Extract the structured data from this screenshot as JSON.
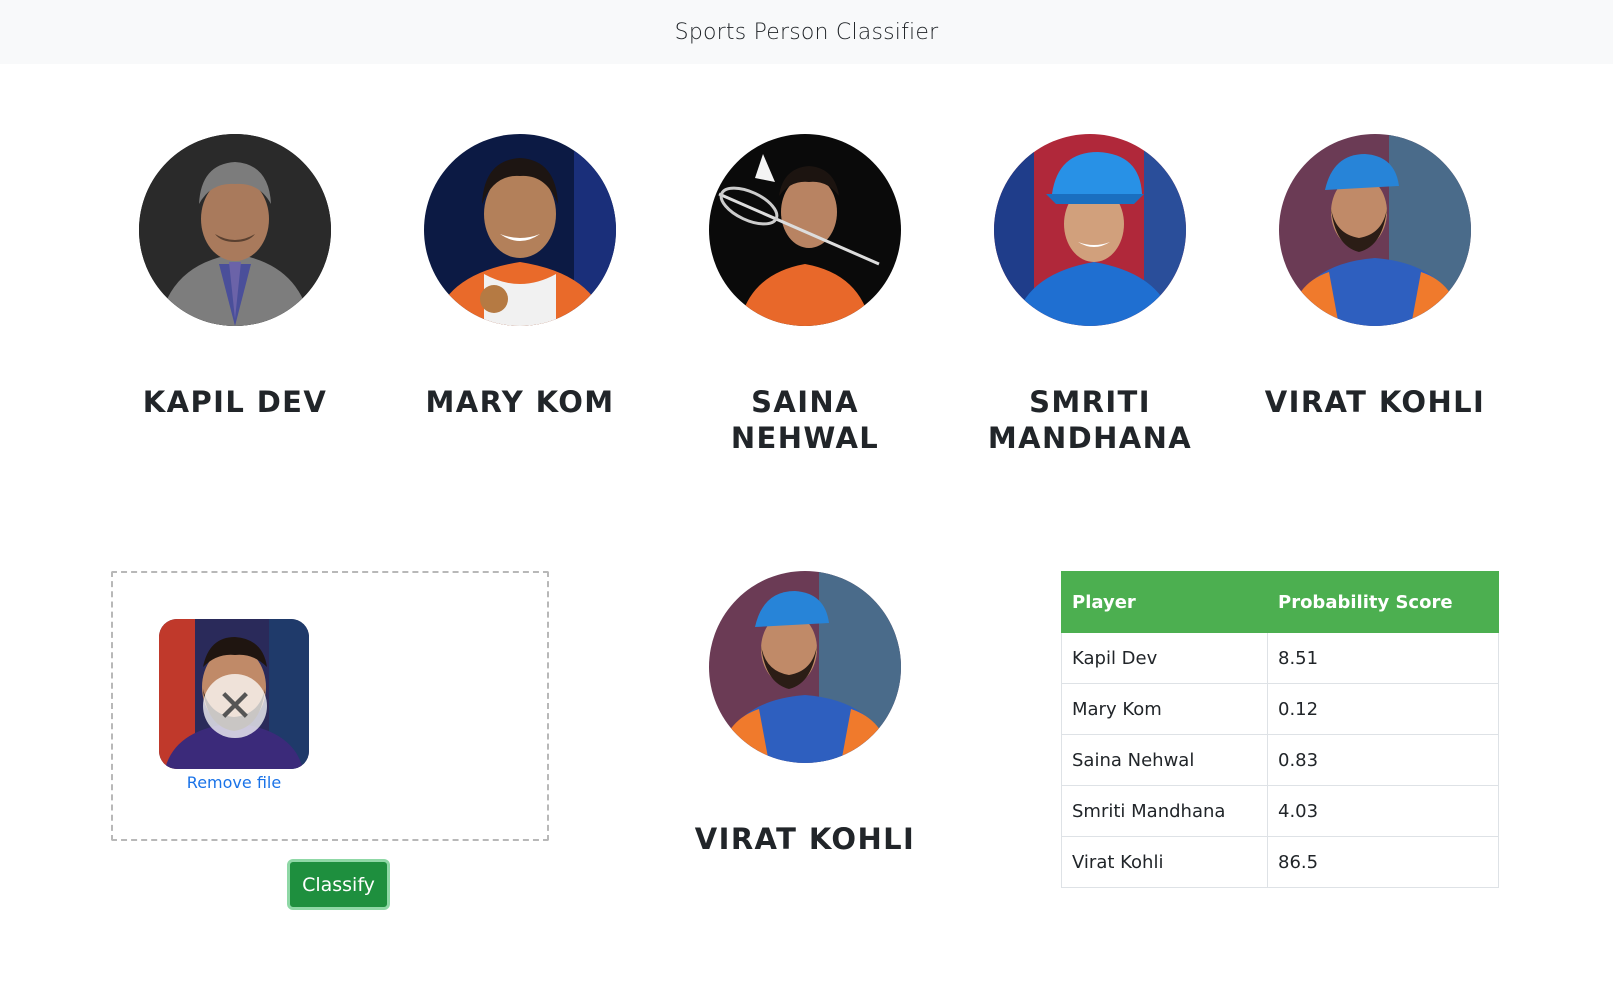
{
  "navbar": {
    "title": "Sports Person Classifier"
  },
  "players": [
    {
      "name": "KAPIL DEV"
    },
    {
      "name": "MARY KOM"
    },
    {
      "name": "SAINA NEHWAL"
    },
    {
      "name": "SMRITI MANDHANA"
    },
    {
      "name": "VIRAT KOHLI"
    }
  ],
  "upload": {
    "remove_label": "Remove file",
    "remove_icon": "close-icon"
  },
  "classify_button": {
    "label": "Classify"
  },
  "result": {
    "name": "VIRAT KOHLI"
  },
  "scores_table": {
    "headers": [
      "Player",
      "Probability Score"
    ],
    "rows": [
      [
        "Kapil Dev",
        "8.51"
      ],
      [
        "Mary Kom",
        "0.12"
      ],
      [
        "Saina Nehwal",
        "0.83"
      ],
      [
        "Smriti Mandhana",
        "4.03"
      ],
      [
        "Virat Kohli",
        "86.5"
      ]
    ]
  },
  "colors": {
    "navbar_bg": "#f8f9fa",
    "table_header_bg": "#4caf50",
    "button_bg": "#1e8f3e",
    "link": "#1a73e8"
  }
}
